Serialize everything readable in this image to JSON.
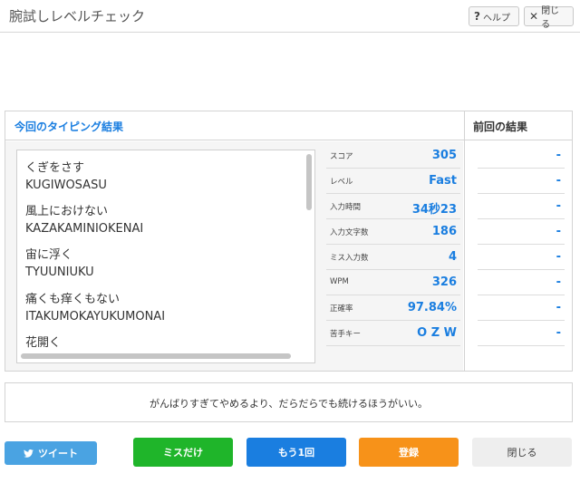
{
  "header": {
    "title": "腕試しレベルチェック",
    "help_label": "ヘルプ",
    "close_label": "閉じる"
  },
  "current": {
    "title": "今回のタイピング結果",
    "words": [
      {
        "kana": "くぎをさす",
        "romaji": "KUGIWOSASU"
      },
      {
        "kana": "風上におけない",
        "romaji": "KAZAKAMINIOKENAI"
      },
      {
        "kana": "宙に浮く",
        "romaji": "TYUUNIUKU"
      },
      {
        "kana": "痛くも痒くもない",
        "romaji": "ITAKUMOKAYUKUMONAI"
      },
      {
        "kana": "花開く",
        "romaji": ""
      }
    ],
    "stats": [
      {
        "label": "スコア",
        "value": "305"
      },
      {
        "label": "レベル",
        "value": "Fast"
      },
      {
        "label": "入力時間",
        "value": "34秒23"
      },
      {
        "label": "入力文字数",
        "value": "186"
      },
      {
        "label": "ミス入力数",
        "value": "4"
      },
      {
        "label": "WPM",
        "value": "326"
      },
      {
        "label": "正確率",
        "value": "97.84%"
      },
      {
        "label": "苦手キー",
        "value": "O Z W"
      }
    ]
  },
  "previous": {
    "title": "前回の結果",
    "values": [
      "-",
      "-",
      "-",
      "-",
      "-",
      "-",
      "-",
      "-"
    ]
  },
  "quote": "がんばりすぎてやめるより、だらだらでも続けるほうがいい。",
  "buttons": {
    "tweet": "ツイート",
    "miss_only": "ミスだけ",
    "retry": "もう1回",
    "register": "登録",
    "close": "閉じる"
  },
  "colors": {
    "accent_blue": "#1a7ee0",
    "green": "#1fb52a",
    "orange": "#f79219",
    "twitter": "#4aa3e2"
  }
}
